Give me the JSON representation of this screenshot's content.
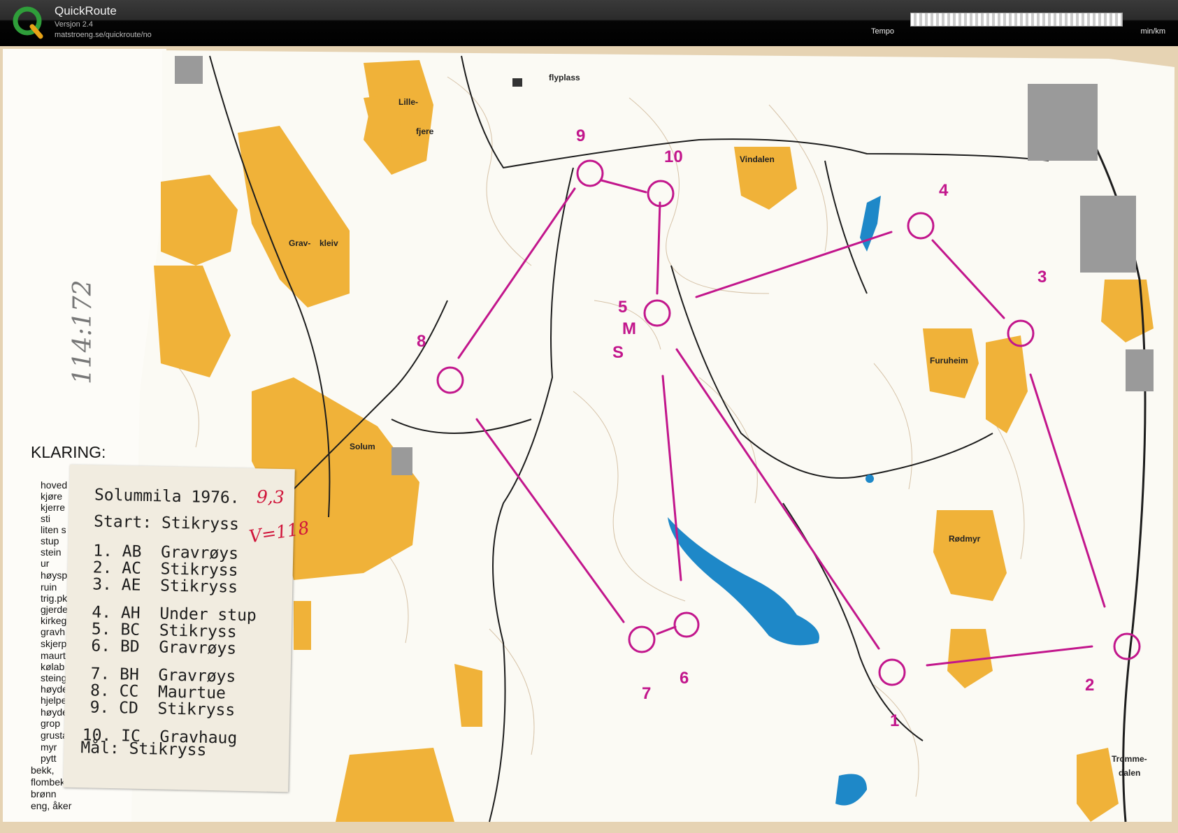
{
  "app": {
    "title": "QuickRoute",
    "version": "Versjon 2.4",
    "url": "matstroeng.se/quickroute/no",
    "tempo_label": "Tempo",
    "tempo_unit": "min/km"
  },
  "colors": {
    "course": "#c2168c",
    "open_land": "#f0b239",
    "water": "#1e88c8",
    "contour": "#b8956a",
    "paper": "#e6d3b3"
  },
  "map": {
    "place_names": [
      "flyplass",
      "Lille-",
      "fjere",
      "Vindalen",
      "Grav-",
      "kleiv",
      "Solum",
      "Furuheim",
      "Rødmyr",
      "Tromme-",
      "dalen"
    ],
    "course_control_numbers": [
      "1",
      "2",
      "3",
      "4",
      "5",
      "6",
      "7",
      "8",
      "9",
      "10"
    ],
    "start_symbol": [
      "M",
      "S"
    ],
    "margin_handwriting": "114:172",
    "legend_heading": "KLARING:",
    "legend_items": [
      "hoved",
      "kjøre",
      "kjerre",
      "sti",
      "liten s",
      "stup",
      "stein",
      "ur",
      "høysp",
      "ruin",
      "trig.pk",
      "gjerde",
      "kirkeg",
      "gravh",
      "skjerp",
      "maurt",
      "kølab",
      "steing",
      "høyde",
      "hjelpe",
      "høyde",
      "grop",
      "grusta",
      "myr",
      "pytt",
      "bekk,",
      "flombekk, grøft, tørr",
      "brønn",
      "eng, åker"
    ]
  },
  "course_card": {
    "title": "Solummila 1976.",
    "start": "Start: Stikryss",
    "controls": [
      "1. AB  Gravrøys",
      "2. AC  Stikryss",
      "3. AE  Stikryss",
      "4. AH  Under stup",
      "5. BC  Stikryss",
      "6. BD  Gravrøys",
      "7. BH  Gravrøys",
      "8. CC  Maurtue",
      "9. CD  Stikryss",
      "10. IC  Gravhaug"
    ],
    "finish": "Mål: Stikryss",
    "handwritten_distance": "9,3",
    "handwritten_climb": "V=118"
  }
}
